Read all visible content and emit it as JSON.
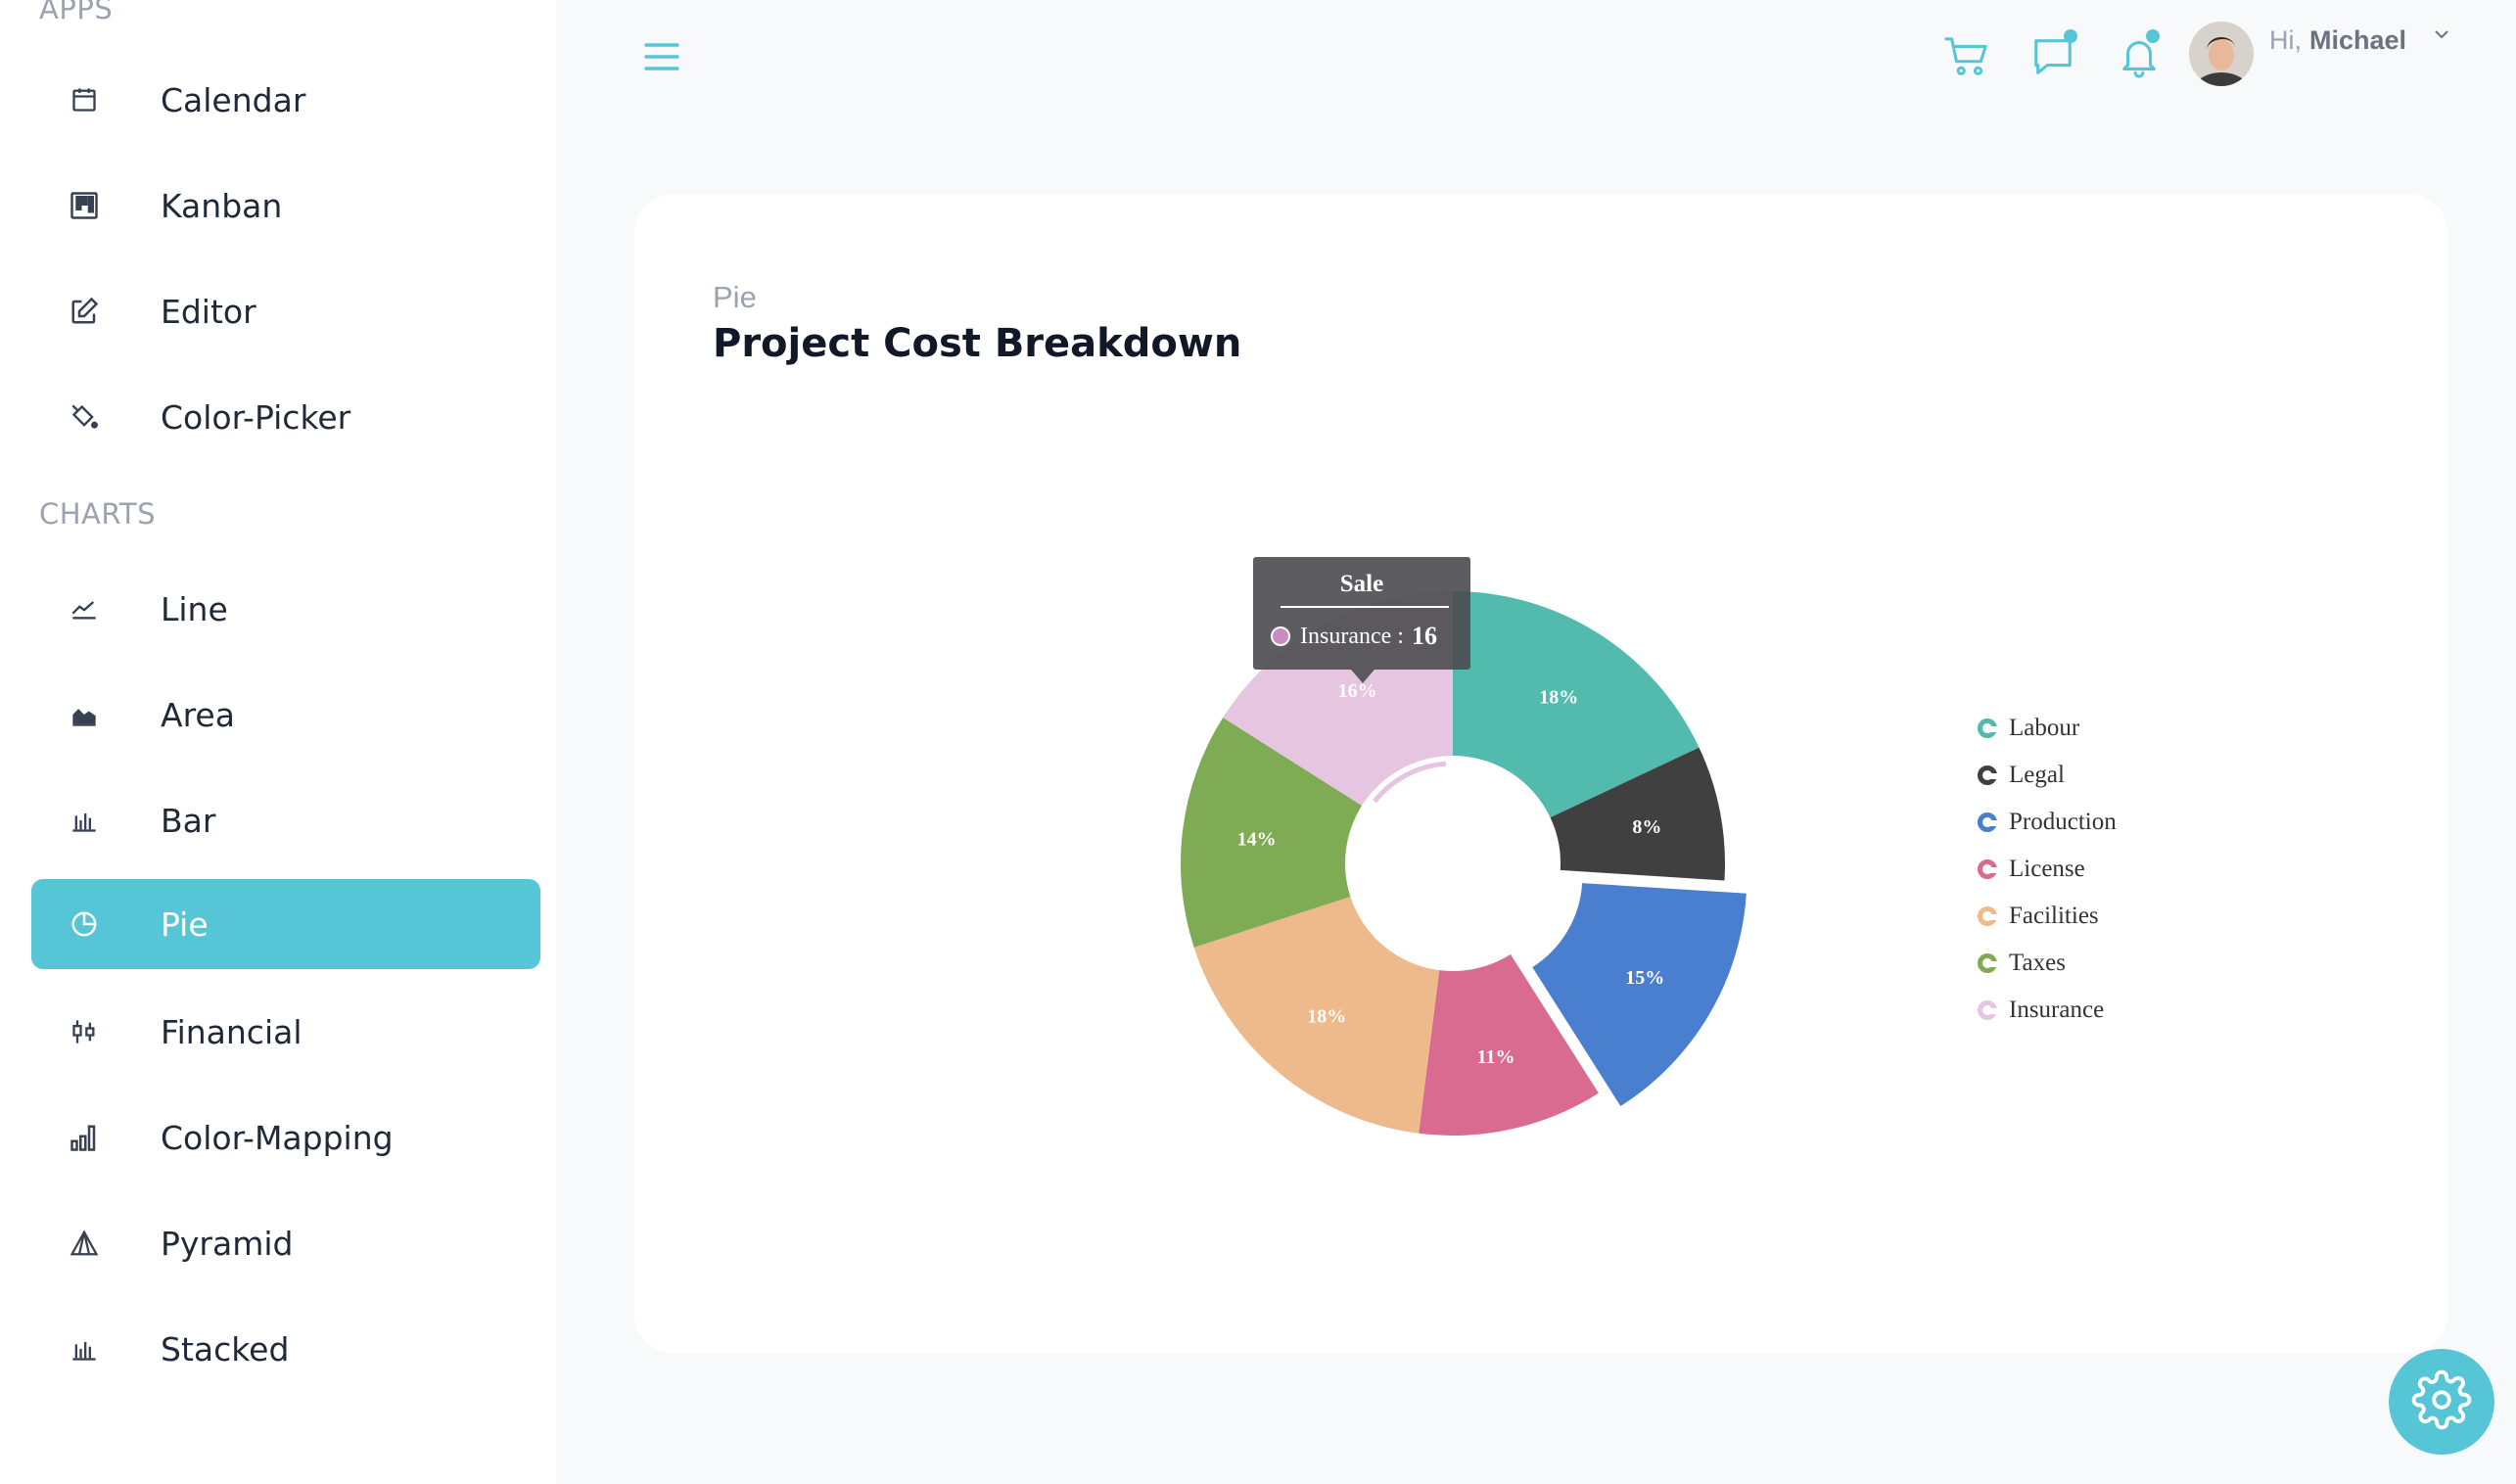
{
  "sidebar": {
    "apps_title": "APPS",
    "charts_title": "CHARTS",
    "apps": [
      {
        "label": "Calendar",
        "icon": "calendar-icon"
      },
      {
        "label": "Kanban",
        "icon": "kanban-icon"
      },
      {
        "label": "Editor",
        "icon": "edit-icon"
      },
      {
        "label": "Color-Picker",
        "icon": "paint-bucket-icon"
      }
    ],
    "charts": [
      {
        "label": "Line",
        "icon": "line-chart-icon"
      },
      {
        "label": "Area",
        "icon": "area-chart-icon"
      },
      {
        "label": "Bar",
        "icon": "bar-chart-icon"
      },
      {
        "label": "Pie",
        "icon": "pie-chart-icon",
        "active": true
      },
      {
        "label": "Financial",
        "icon": "candlestick-icon"
      },
      {
        "label": "Color-Mapping",
        "icon": "column-chart-icon"
      },
      {
        "label": "Pyramid",
        "icon": "pyramid-icon"
      },
      {
        "label": "Stacked",
        "icon": "stacked-bar-icon"
      }
    ]
  },
  "header": {
    "greeting": "Hi,",
    "user_name": "Michael",
    "accent_color": "#56c5d6"
  },
  "card": {
    "subtitle": "Pie",
    "title": "Project Cost Breakdown"
  },
  "tooltip": {
    "header": "Sale",
    "label": "Insurance :",
    "value": "16"
  },
  "chart_data": {
    "type": "pie",
    "title": "Project Cost Breakdown",
    "series_name": "Sale",
    "donut": true,
    "legend_position": "right",
    "slices": [
      {
        "name": "Labour",
        "value": 18,
        "label": "18%",
        "color": "#52bbae"
      },
      {
        "name": "Legal",
        "value": 8,
        "label": "8%",
        "color": "#404040"
      },
      {
        "name": "Production",
        "value": 15,
        "label": "15%",
        "color": "#4a7ecf",
        "exploded": true
      },
      {
        "name": "License",
        "value": 11,
        "label": "11%",
        "color": "#d86b8f"
      },
      {
        "name": "Facilities",
        "value": 18,
        "label": "18%",
        "color": "#eeb98b"
      },
      {
        "name": "Taxes",
        "value": 14,
        "label": "14%",
        "color": "#80ab55"
      },
      {
        "name": "Insurance",
        "value": 16,
        "label": "16%",
        "color": "#e6c5e0"
      }
    ]
  }
}
